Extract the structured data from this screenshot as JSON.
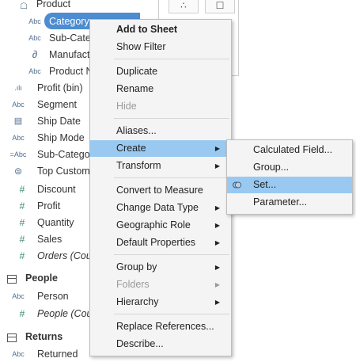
{
  "data_pane": {
    "product_header": "Product",
    "fields": [
      {
        "icon": "Abc",
        "label": "Category"
      },
      {
        "icon": "Abc",
        "label": "Sub-Cate"
      },
      {
        "icon": "∂",
        "label": "Manufact"
      },
      {
        "icon": "Abc",
        "label": "Product N"
      },
      {
        "icon": ".ılı",
        "label": "Profit (bin)"
      },
      {
        "icon": "Abc",
        "label": "Segment"
      },
      {
        "icon": "▤",
        "label": "Ship Date"
      },
      {
        "icon": "Abc",
        "label": "Ship Mode"
      },
      {
        "icon": "=Abc",
        "label": "Sub-Catego"
      },
      {
        "icon": "⊜",
        "label": "Top Custom"
      },
      {
        "icon": "#",
        "label": "Discount"
      },
      {
        "icon": "#",
        "label": "Profit"
      },
      {
        "icon": "#",
        "label": "Quantity"
      },
      {
        "icon": "#",
        "label": "Sales"
      },
      {
        "icon": "#",
        "label": "Orders (Cou"
      }
    ],
    "people_header": "People",
    "people_fields": [
      {
        "icon": "Abc",
        "label": "Person"
      },
      {
        "icon": "#",
        "label": "People (Cou"
      }
    ],
    "returns_header": "Returns",
    "returns_fields": [
      {
        "icon": "Abc",
        "label": "Returned"
      }
    ]
  },
  "toolbox": {
    "btn1": "∴",
    "btn2": "☐"
  },
  "context_menu": {
    "items": [
      {
        "label": "Add to Sheet"
      },
      {
        "label": "Show Filter"
      },
      {
        "label": "Duplicate"
      },
      {
        "label": "Rename"
      },
      {
        "label": "Hide"
      },
      {
        "label": "Aliases..."
      },
      {
        "label": "Create"
      },
      {
        "label": "Transform"
      },
      {
        "label": "Convert to Measure"
      },
      {
        "label": "Change Data Type"
      },
      {
        "label": "Geographic Role"
      },
      {
        "label": "Default Properties"
      },
      {
        "label": "Group by"
      },
      {
        "label": "Folders"
      },
      {
        "label": "Hierarchy"
      },
      {
        "label": "Replace References..."
      },
      {
        "label": "Describe..."
      }
    ]
  },
  "submenu": {
    "items": [
      {
        "label": "Calculated Field..."
      },
      {
        "label": "Group..."
      },
      {
        "label": "Set..."
      },
      {
        "label": "Parameter..."
      }
    ]
  },
  "colors": {
    "selection": "#4d8cd0",
    "highlight": "#99c9f1",
    "menu_bg": "#f4f4f4"
  }
}
